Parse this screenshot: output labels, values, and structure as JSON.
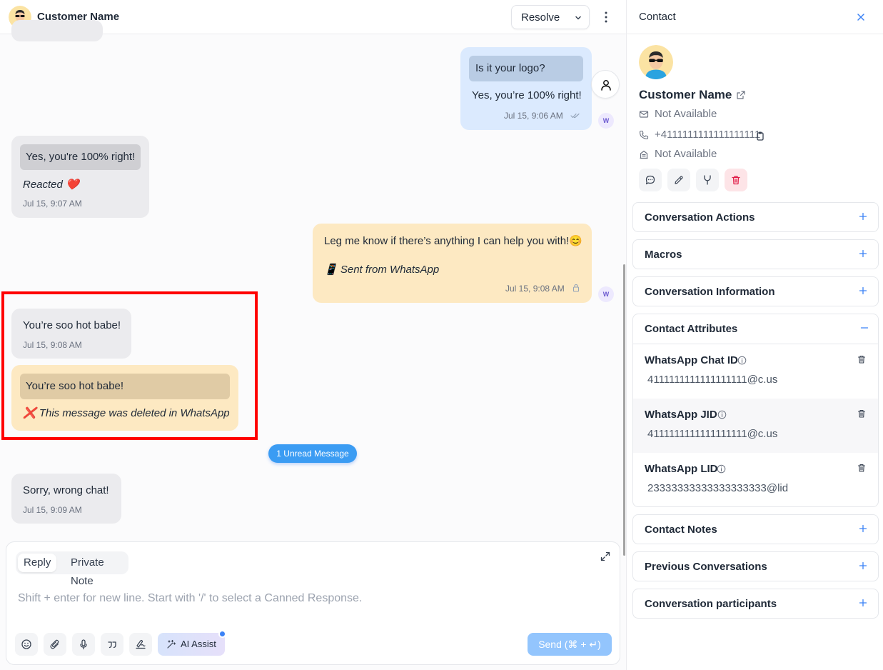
{
  "header": {
    "customer_name": "Customer Name",
    "resolve_label": "Resolve"
  },
  "messages": {
    "outgoing_1": {
      "quote": "Is it your logo?",
      "text": "Yes, you’re 100% right!",
      "time": "Jul 15, 9:06 AM",
      "badge": "W"
    },
    "incoming_1": {
      "quote": "Yes, you're 100% right!",
      "text": "Reacted ❤️",
      "time": "Jul 15, 9:07 AM"
    },
    "outgoing_2": {
      "text": "Leg me know if there’s anything I can help you with!😊",
      "signature": "📱 Sent from WhatsApp",
      "time": "Jul 15, 9:08 AM",
      "badge": "W"
    },
    "incoming_2": {
      "text": "You’re soo hot babe!",
      "time": "Jul 15, 9:08 AM"
    },
    "deleted_notice": {
      "quote": "You’re soo hot babe!",
      "text": "❌ This message was deleted in WhatsApp"
    },
    "unread_label": "1 Unread Message",
    "incoming_3": {
      "text": "Sorry, wrong chat!",
      "time": "Jul 15, 9:09 AM"
    }
  },
  "composer": {
    "tab_reply": "Reply",
    "tab_private_note": "Private Note",
    "placeholder": "Shift + enter for new line. Start with '/' to select a Canned Response.",
    "ai_assist_label": "AI Assist",
    "send_label": "Send (⌘ + ↵)",
    "tool_icons": [
      "emoji-icon",
      "attachment-icon",
      "microphone-icon",
      "quote-icon",
      "signature-icon"
    ]
  },
  "contact_panel": {
    "title": "Contact",
    "name": "Customer Name",
    "email": "Not Available",
    "phone": "+4111111111111111111",
    "company": "Not Available",
    "sections": {
      "conversation_actions": "Conversation Actions",
      "macros": "Macros",
      "conversation_information": "Conversation Information",
      "contact_attributes": "Contact Attributes",
      "contact_notes": "Contact Notes",
      "previous_conversations": "Previous Conversations",
      "conversation_participants": "Conversation participants"
    },
    "attributes": [
      {
        "label": "WhatsApp Chat ID",
        "value": "4111111111111111111@c.us"
      },
      {
        "label": "WhatsApp JID",
        "value": "4111111111111111111@c.us"
      },
      {
        "label": "WhatsApp LID",
        "value": "23333333333333333333@lid"
      }
    ]
  },
  "colors": {
    "accent": "#3b82f6",
    "incoming_bubble": "#ebebee",
    "outgoing_blue_bubble": "#dbeafe",
    "outgoing_yellow_bubble": "#fde9c2",
    "highlight_border": "#ff0000",
    "send_button": "#93c5fd"
  }
}
